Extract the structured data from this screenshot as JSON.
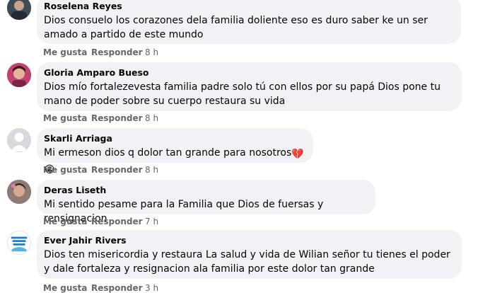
{
  "comments": [
    {
      "author": "Roselena Reyes",
      "text": "Dios consuelo los corazones dela familia doliente eso es duro saber ke un ser amado a partido de este mundo",
      "like": "Me gusta",
      "reply": "Responder",
      "time": "8 h",
      "avatar": "profile-photo"
    },
    {
      "author": "Gloria Amparo Bueso",
      "text": "Dios mío fortalezevesta familia padre solo tú con ellos por su papá Dios pone tu mano de poder sobre su cuerpo restaura su vida",
      "like": "Me gusta",
      "reply": "Responder",
      "time": "8 h",
      "avatar": "profile-photo"
    },
    {
      "author": "Skarli Arriaga",
      "text": "Mi ermeson dios q dolor tan grande para nosotros",
      "emojis": [
        "💔",
        "😭"
      ],
      "like": "Me gusta",
      "reply": "Responder",
      "time": "8 h",
      "avatar": "default-silhouette"
    },
    {
      "author": "Deras Liseth",
      "text": "Mi sentido pesame para la Familia que Dios de fuersas y rensignacion",
      "like": "Me gusta",
      "reply": "Responder",
      "time": "7 h",
      "avatar": "profile-photo"
    },
    {
      "author": "Ever Jahir Rivers",
      "text": "Dios ten misericordia y restaura La salud y vida de Wilian señor tu tienes el poder y dale fortaleza y resignacion ala familia por este dolor tan grande",
      "like": "Me gusta",
      "reply": "Responder",
      "time": "3 h",
      "avatar": "logo-image"
    }
  ],
  "colors": {
    "bubble": "#f0f2f5",
    "text": "#050505",
    "meta": "#65676b"
  }
}
